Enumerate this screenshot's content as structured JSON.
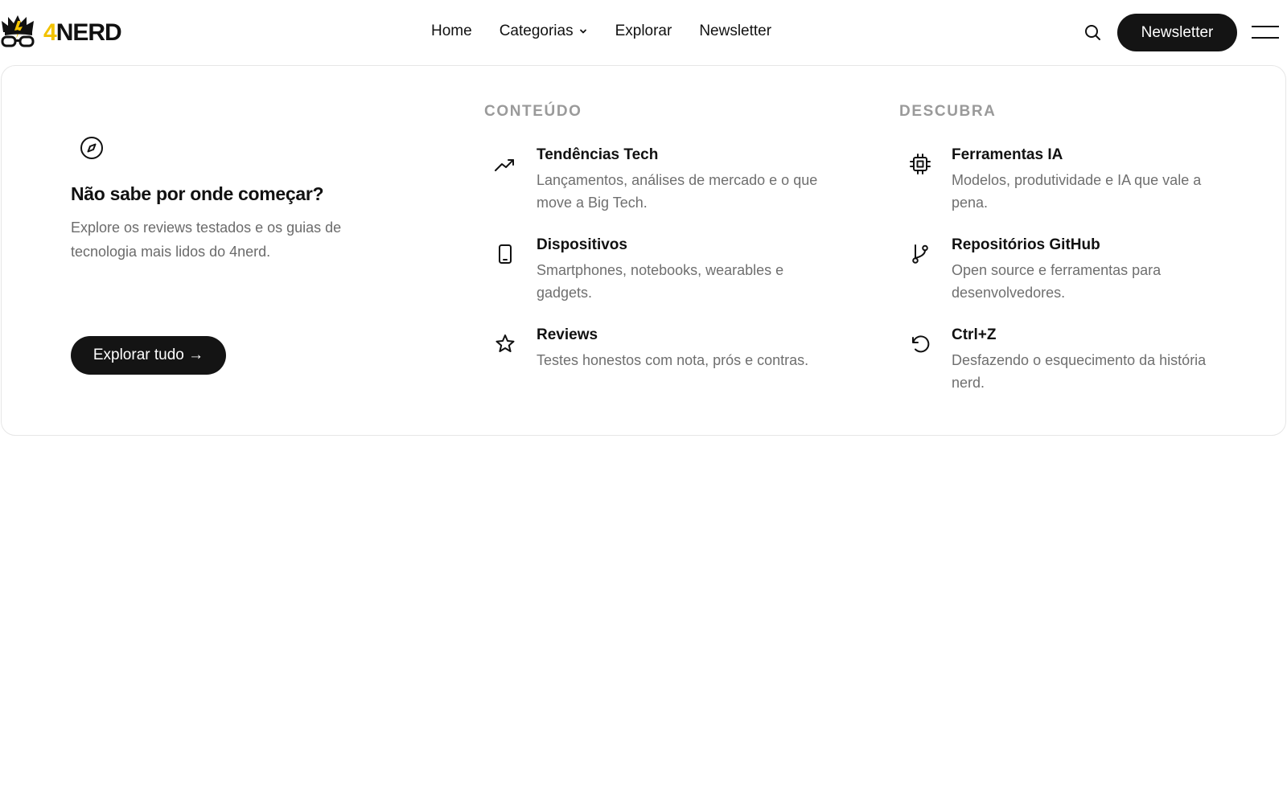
{
  "brand": {
    "logo_text_accent": "4",
    "logo_text": "NERD",
    "accent_color": "#f2c200"
  },
  "nav": {
    "items": [
      {
        "label": "Home"
      },
      {
        "label": "Categorias"
      },
      {
        "label": "Explorar"
      },
      {
        "label": "Newsletter"
      }
    ]
  },
  "header": {
    "cta_label": "Newsletter",
    "search_icon": "search-icon",
    "menu_icon": "hamburger-menu-icon"
  },
  "mega_menu": {
    "intro": {
      "icon": "compass-icon",
      "title": "Não sabe por onde começar?",
      "text": "Explore os reviews testados e os guias de tecnologia mais lidos do 4nerd.",
      "button_label": "Explorar tudo →"
    },
    "columns": [
      {
        "title": "CONTEÚDO",
        "items": [
          {
            "icon": "trending-up-icon",
            "title": "Tendências Tech",
            "desc": "Lançamentos, análises de mercado e o que move a Big Tech."
          },
          {
            "icon": "smartphone-icon",
            "title": "Dispositivos",
            "desc": "Smartphones, notebooks, wearables e gadgets."
          },
          {
            "icon": "star-icon",
            "title": "Reviews",
            "desc": "Testes honestos com nota, prós e contras."
          }
        ]
      },
      {
        "title": "DESCUBRA",
        "items": [
          {
            "icon": "cpu-icon",
            "title": "Ferramentas IA",
            "desc": "Modelos, produtividade e IA que vale a pena."
          },
          {
            "icon": "git-branch-icon",
            "title": "Repositórios GitHub",
            "desc": "Open source e ferramentas para desenvolvedores."
          },
          {
            "icon": "undo-icon",
            "title": "Ctrl+Z",
            "desc": "Desfazendo o esquecimento da história nerd."
          }
        ]
      }
    ]
  }
}
